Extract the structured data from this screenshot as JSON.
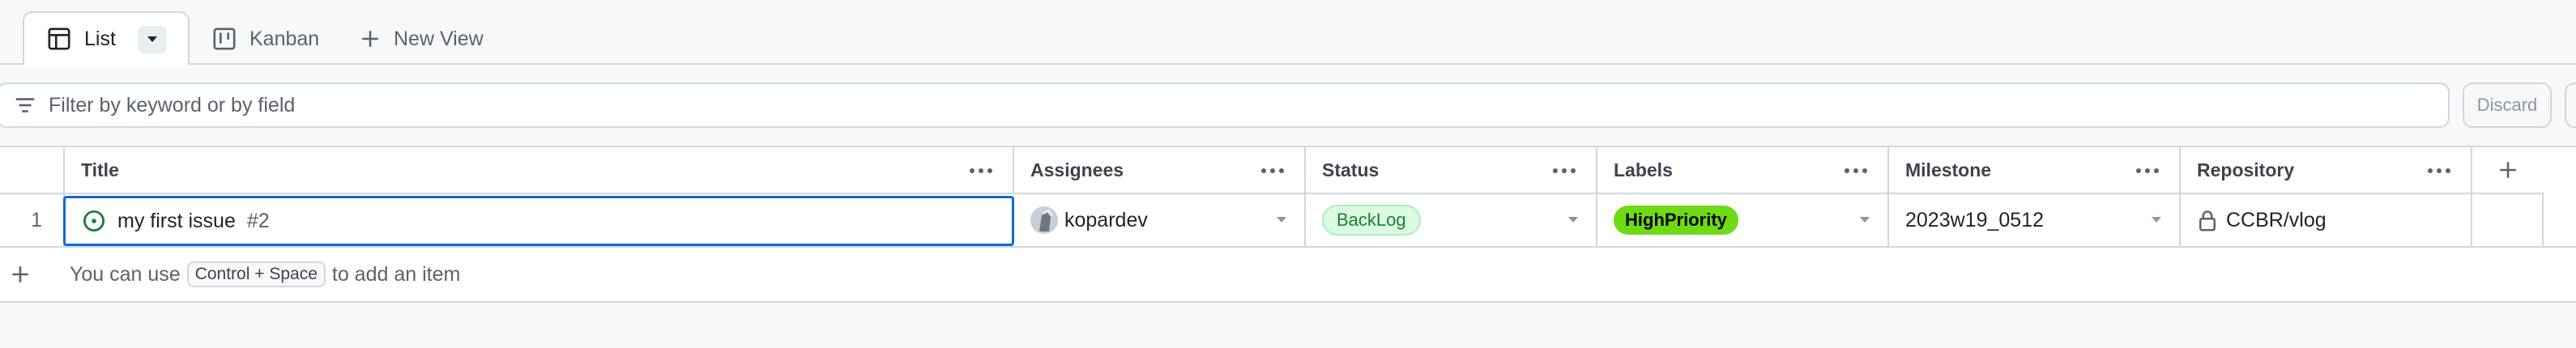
{
  "views": {
    "tabs": [
      {
        "label": "List",
        "icon": "table-icon",
        "active": true
      },
      {
        "label": "Kanban",
        "icon": "kanban-icon",
        "active": false
      }
    ],
    "new_view_label": "New View"
  },
  "filter": {
    "placeholder": "Filter by keyword or by field",
    "discard_label": "Discard"
  },
  "table": {
    "columns": [
      {
        "label": "Title"
      },
      {
        "label": "Assignees"
      },
      {
        "label": "Status"
      },
      {
        "label": "Labels"
      },
      {
        "label": "Milestone"
      },
      {
        "label": "Repository"
      }
    ],
    "rows": [
      {
        "index": "1",
        "title": "my first issue",
        "number": "#2",
        "assignee": "kopardev",
        "status": "BackLog",
        "label": "HighPriority",
        "milestone": "2023w19_0512",
        "repository": "CCBR/vlog"
      }
    ],
    "add_item": {
      "prefix": "You can use",
      "shortcut": "Control + Space",
      "suffix": "to add an item"
    }
  },
  "colors": {
    "accent": "#0969da",
    "status_open": "#1a7f37",
    "label_high_priority": "#6edb16",
    "border": "#d0d7de"
  }
}
